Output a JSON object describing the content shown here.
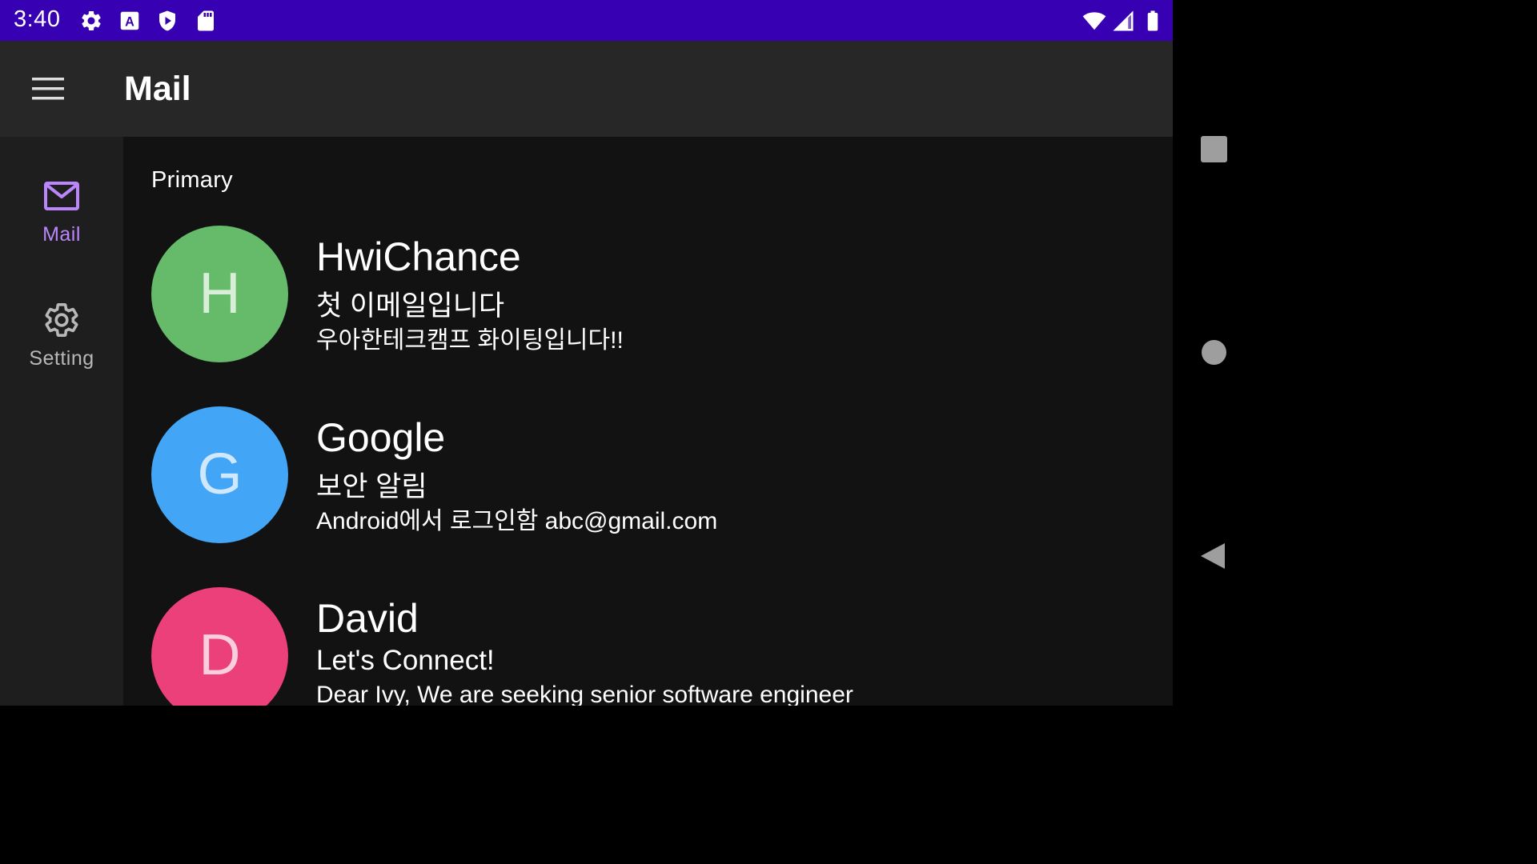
{
  "status_bar": {
    "time": "3:40",
    "background": "#3700B3",
    "left_icons": [
      "gear-icon",
      "text-a-icon",
      "shield-play-icon",
      "sd-card-icon"
    ],
    "right_icons": [
      "wifi-icon",
      "signal-icon",
      "battery-icon"
    ]
  },
  "app_bar": {
    "title": "Mail",
    "menu_icon": "menu-icon"
  },
  "nav_rail": {
    "items": [
      {
        "label": "Mail",
        "icon": "mail-icon",
        "selected": true
      },
      {
        "label": "Setting",
        "icon": "gear-icon",
        "selected": false
      }
    ],
    "selected_color": "#BB86FC"
  },
  "content": {
    "section_header": "Primary",
    "mails": [
      {
        "initial": "H",
        "avatar_color": "#66BB6A",
        "sender": "HwiChance",
        "subject": "첫 이메일입니다",
        "preview": "우아한테크캠프 화이팅입니다!!"
      },
      {
        "initial": "G",
        "avatar_color": "#42A5F5",
        "sender": "Google",
        "subject": "보안 알림",
        "preview": "Android에서 로그인함 abc@gmail.com"
      },
      {
        "initial": "D",
        "avatar_color": "#EC407A",
        "sender": "David",
        "subject": "Let's Connect!",
        "preview": "Dear Ivy, We are seeking senior software engineer"
      }
    ]
  },
  "system_nav": {
    "buttons": [
      "recents-button",
      "home-button",
      "back-button"
    ]
  }
}
